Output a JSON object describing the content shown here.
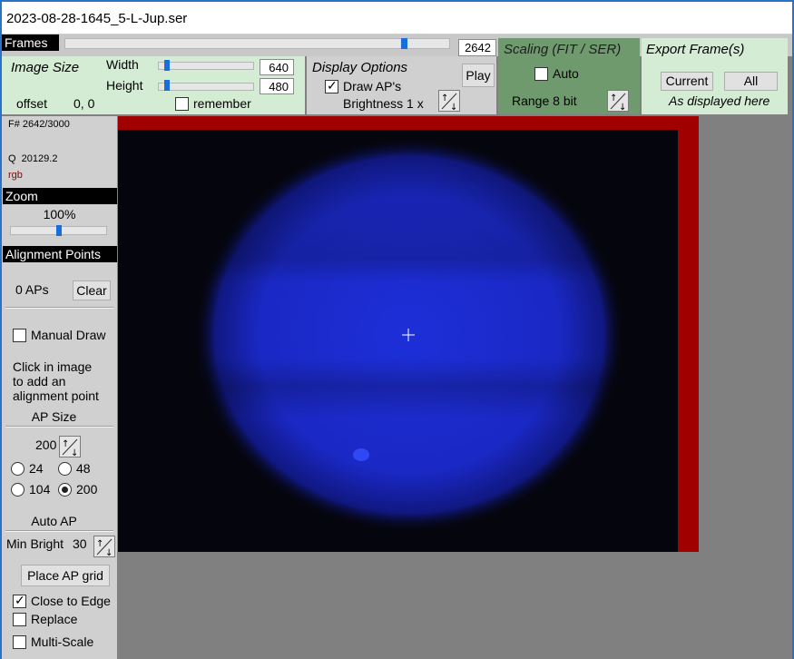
{
  "window": {
    "title": "2023-08-28-1645_5-L-Jup.ser"
  },
  "frames": {
    "label": "Frames",
    "current": "2642",
    "total": 3000,
    "fraction": 0.881
  },
  "image_size": {
    "title": "Image Size",
    "width_label": "Width",
    "width_value": "640",
    "height_label": "Height",
    "height_value": "480",
    "offset_label": "offset",
    "offset_value": "0, 0",
    "remember_label": "remember",
    "remember_checked": false
  },
  "display_options": {
    "title": "Display Options",
    "draw_aps_label": "Draw AP's",
    "draw_aps_checked": true,
    "brightness_label": "Brightness 1 x",
    "play_label": "Play"
  },
  "scaling": {
    "title": "Scaling (FIT / SER)",
    "auto_label": "Auto",
    "auto_checked": false,
    "range_label": "Range 8 bit"
  },
  "export": {
    "title": "Export Frame(s)",
    "current_label": "Current",
    "all_label": "All",
    "note": "As displayed here"
  },
  "info": {
    "frame_number": "F# 2642/3000",
    "quality": "Q  20129.2",
    "color_mode": "rgb"
  },
  "zoom": {
    "title": "Zoom",
    "value": "100%",
    "fraction": 0.5
  },
  "alignment_points": {
    "title": "Alignment Points",
    "count_label": "0 APs",
    "clear_label": "Clear",
    "manual_draw_label": "Manual Draw",
    "manual_draw_checked": false,
    "hint": "Click in image to add an alignment point",
    "ap_size_title": "AP Size",
    "ap_size_value": "200",
    "size_options": [
      "24",
      "48",
      "104",
      "200"
    ],
    "selected_size": "200",
    "auto_ap_title": "Auto AP",
    "min_bright_label": "Min Bright",
    "min_bright_value": "30",
    "place_grid_label": "Place AP grid",
    "close_to_edge_label": "Close to Edge",
    "close_to_edge_checked": true,
    "replace_label": "Replace",
    "replace_checked": false,
    "multi_scale_label": "Multi-Scale",
    "multi_scale_checked": false
  },
  "colors": {
    "image_border": "#a00000",
    "planet": "#1a2bd0",
    "panel_green": "#d3ecd3",
    "panel_dark_green": "#6e9a6e"
  }
}
